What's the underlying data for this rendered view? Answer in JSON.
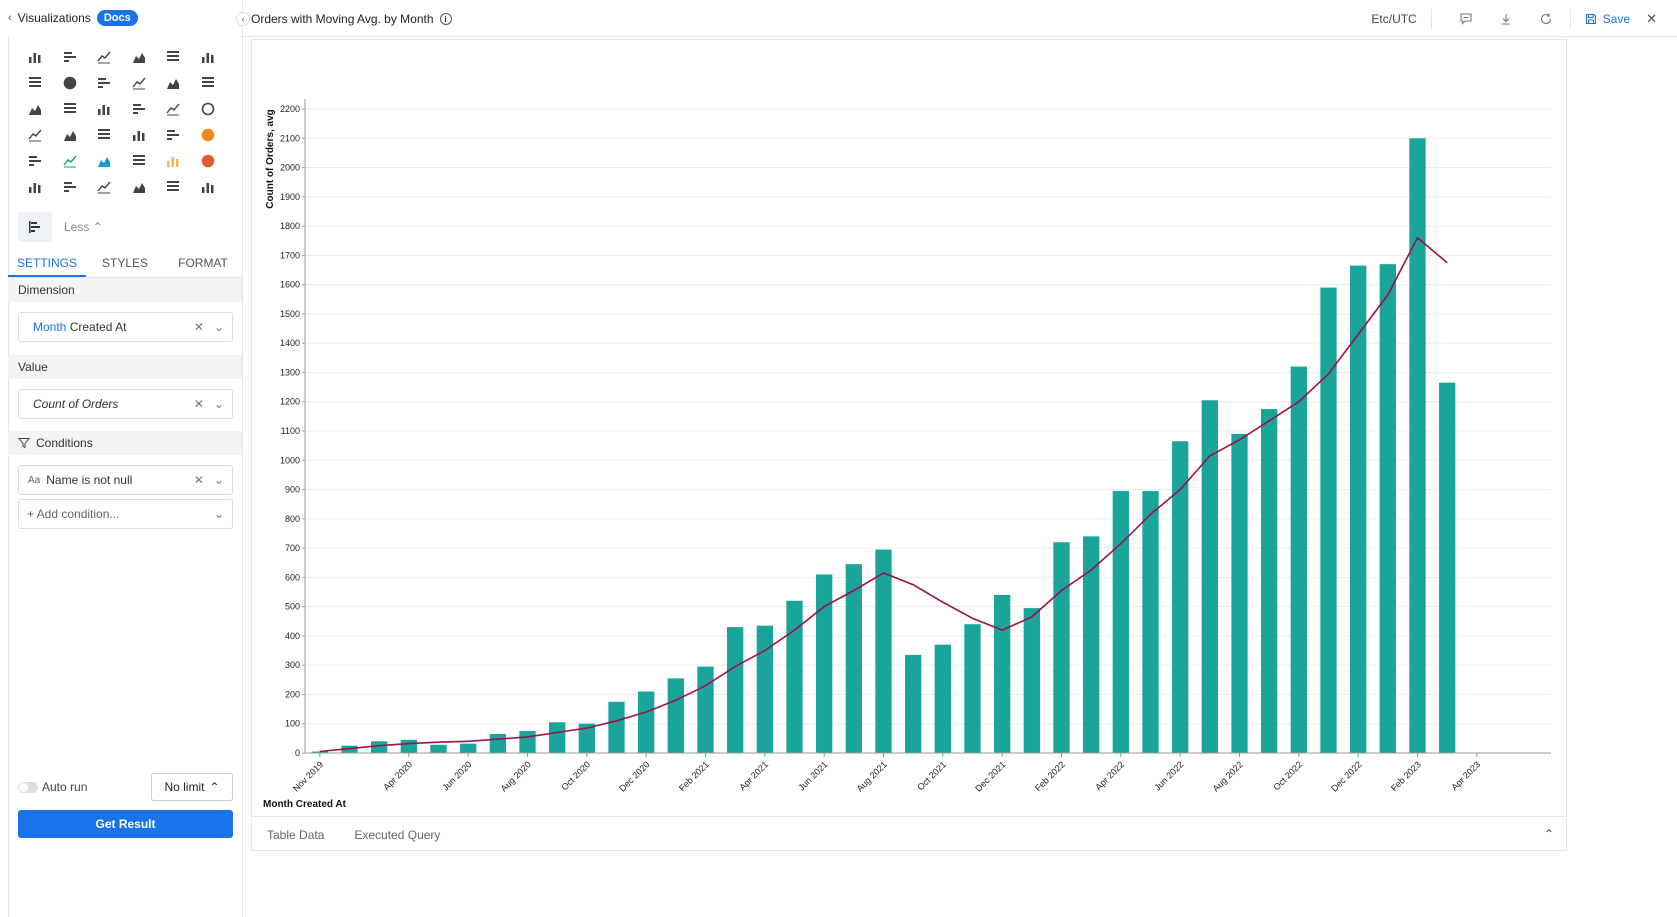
{
  "left_panel": {
    "title": "Visualizations",
    "docs_label": "Docs",
    "less_label": "Less",
    "tabs": [
      {
        "label": "SETTINGS",
        "active": true
      },
      {
        "label": "STYLES",
        "active": false
      },
      {
        "label": "FORMAT",
        "active": false
      }
    ],
    "dimension": {
      "heading": "Dimension",
      "field_accent": "Month",
      "field_rest": "Created At"
    },
    "value": {
      "heading": "Value",
      "field": "Count of Orders"
    },
    "conditions": {
      "heading": "Conditions",
      "type_glyph": "Aa",
      "field": "Name is not null",
      "add_placeholder": "+ Add condition..."
    },
    "auto_run_label": "Auto run",
    "limit_label": "No limit",
    "get_result_label": "Get Result"
  },
  "topbar": {
    "chart_title": "Orders with Moving Avg. by Month",
    "timezone": "Etc/UTC",
    "save_label": "Save"
  },
  "bottom_tabs": {
    "table_data": "Table Data",
    "executed_query": "Executed Query"
  },
  "colors": {
    "bar": "#1aa59a",
    "line": "#a0104a",
    "accent": "#1a73e8"
  },
  "chart_data": {
    "type": "bar",
    "xlabel": "Month Created At",
    "ylabel": "Count of Orders, avg",
    "ylim": [
      0,
      2200
    ],
    "ytick_step": 100,
    "grid": true,
    "categories": [
      "Nov 2019",
      "Dec 2019",
      "Jan 2020",
      "Feb 2020",
      "Mar 2020",
      "Apr 2020",
      "May 2020",
      "Jun 2020",
      "Jul 2020",
      "Aug 2020",
      "Sep 2020",
      "Oct 2020",
      "Nov 2020",
      "Dec 2020",
      "Jan 2021",
      "Feb 2021",
      "Mar 2021",
      "Apr 2021",
      "May 2021",
      "Jun 2021",
      "Jul 2021",
      "Aug 2021",
      "Sep 2021",
      "Oct 2021",
      "Nov 2021",
      "Dec 2021",
      "Jan 2022",
      "Feb 2022",
      "Mar 2022",
      "Apr 2022",
      "May 2022",
      "Jun 2022",
      "Jul 2022",
      "Aug 2022",
      "Sep 2022",
      "Oct 2022",
      "Nov 2022",
      "Dec 2022",
      "Jan 2023",
      "Feb 2023",
      "Mar 2023",
      "Apr 2023"
    ],
    "tick_labels": [
      "Nov 2019",
      "",
      "",
      "Apr 2020",
      "",
      "Jun 2020",
      "",
      "Aug 2020",
      "",
      "Oct 2020",
      "",
      "Dec 2020",
      "",
      "Feb 2021",
      "",
      "Apr 2021",
      "",
      "Jun 2021",
      "",
      "Aug 2021",
      "",
      "Oct 2021",
      "",
      "Dec 2021",
      "",
      "Feb 2022",
      "",
      "Apr 2022",
      "",
      "Jun 2022",
      "",
      "Aug 2022",
      "",
      "Oct 2022",
      "",
      "Dec 2022",
      "",
      "Feb 2023",
      "",
      "Apr 2023"
    ],
    "series": [
      {
        "type": "bar",
        "values": [
          5,
          25,
          40,
          45,
          28,
          32,
          65,
          75,
          105,
          100,
          175,
          210,
          255,
          295,
          430,
          435,
          520,
          610,
          645,
          695,
          335,
          370,
          440,
          540,
          495,
          720,
          740,
          895,
          895,
          1065,
          1205,
          1090,
          1175,
          1320,
          1590,
          1665,
          1670,
          2100,
          1265
        ]
      },
      {
        "type": "line",
        "values": [
          5,
          15,
          25,
          32,
          37,
          40,
          47,
          55,
          70,
          85,
          110,
          140,
          180,
          230,
          295,
          350,
          420,
          500,
          555,
          615,
          575,
          515,
          460,
          420,
          465,
          555,
          625,
          715,
          815,
          900,
          1015,
          1070,
          1135,
          1200,
          1295,
          1430,
          1565,
          1760,
          1675
        ]
      }
    ]
  }
}
